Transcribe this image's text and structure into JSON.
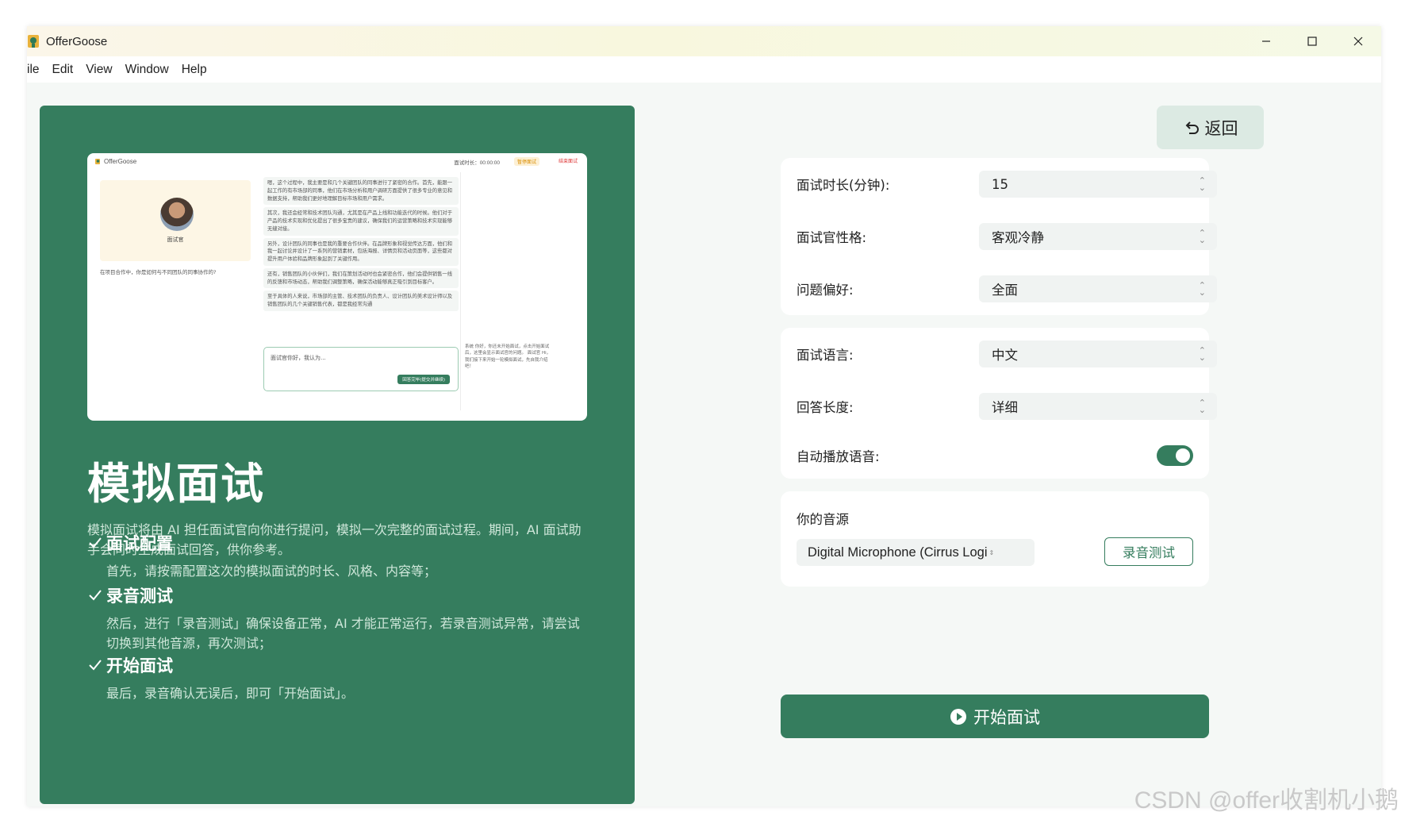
{
  "window": {
    "title": "OfferGoose",
    "controls": [
      "minimize-icon",
      "maximize-icon",
      "close-icon"
    ]
  },
  "menu": [
    "ile",
    "Edit",
    "View",
    "Window",
    "Help"
  ],
  "preview": {
    "logo": "OfferGoose",
    "timer": "面试时长：00:00:00",
    "pause": "暂停面试",
    "end": "结束面试",
    "avatar_label": "面试官",
    "question": "在项目合作中，你是如何与不同团队的同事协作的?",
    "chat": [
      "嗯，这个过程中，我主要是和几个关键团队的同事进行了紧密的合作。首先，能跟一起工作的有市场部的同事，他们在市场分析和用户调研方面提供了很多专业的意见和数据支持，帮助我们更好地理解目标市场和用户需求。",
      "其次，我还会经常和技术团队沟通，尤其是在产品上线和功能迭代的时候。他们对于产品的技术实现和优化提出了很多宝贵的建议，确保我们的运营策略和技术实现能够无缝对接。",
      "另外，设计团队的同事也是我的重要合作伙伴。在品牌形象和视觉传达方面，他们和我一起讨论并设计了一系列的营销素材，包括海报、详情页和活动页面等，这些都对提升用户体验和品牌形象起到了关键作用。",
      "还有，销售团队的小伙伴们，我们在策划活动时也会紧密合作，他们会提供销售一线的反馈和市场动态，帮助我们调整策略，确保活动能够真正吸引到目标客户。",
      "至于具体的人来说，市场部的主管、技术团队的负责人、设计团队的美术设计师以及销售团队的几个关键销售代表，都是我经常沟通"
    ],
    "input_text": "面试官你好，我认为...",
    "input_button": "回答完毕(提交并继续)",
    "side_note": "系统 你好，你还未开始面试，点击开始面试后，这里会显示面试官的问题。 面试官 Hi，我们接下来开始一轮模拟面试，先自我介绍吧！"
  },
  "intro": {
    "title": "模拟面试",
    "description": "模拟面试将由 AI 担任面试官向你进行提问，模拟一次完整的面试过程。期间，AI 面试助手会同时生成面试回答，供你参考。",
    "steps": [
      {
        "title": "面试配置",
        "desc": "首先，请按需配置这次的模拟面试的时长、风格、内容等；"
      },
      {
        "title": "录音测试",
        "desc": "然后，进行「录音测试」确保设备正常，AI 才能正常运行，若录音测试异常，请尝试切换到其他音源，再次测试；"
      },
      {
        "title": "开始面试",
        "desc": "最后，录音确认无误后，即可「开始面试」。"
      }
    ]
  },
  "back_button": "返回",
  "settings": {
    "duration": {
      "label": "面试时长(分钟):",
      "value": "15"
    },
    "personality": {
      "label": "面试官性格:",
      "value": "客观冷静"
    },
    "preference": {
      "label": "问题偏好:",
      "value": "全面"
    },
    "language": {
      "label": "面试语言:",
      "value": "中文"
    },
    "answer_length": {
      "label": "回答长度:",
      "value": "详细"
    },
    "auto_play": {
      "label": "自动播放语音:",
      "enabled": true
    }
  },
  "audio_source": {
    "label": "你的音源",
    "value": "Digital Microphone (Cirrus Logi",
    "test_button": "录音测试"
  },
  "start_button": "开始面试",
  "watermark": "CSDN @offer收割机小鹅",
  "colors": {
    "accent": "#357d5e",
    "panel_bg": "#f5f8f6",
    "back_btn_bg": "#dceae3"
  }
}
